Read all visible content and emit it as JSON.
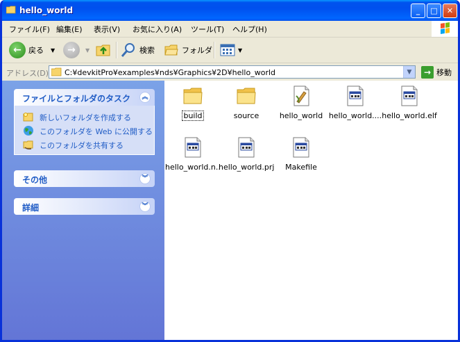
{
  "window": {
    "title": "hello_world",
    "buttons": {
      "minimize": "_",
      "maximize": "□",
      "close": "✕"
    }
  },
  "menu": [
    "ファイル(F)",
    "編集(E)",
    "表示(V)",
    "お気に入り(A)",
    "ツール(T)",
    "ヘルプ(H)"
  ],
  "toolbar": {
    "back": "戻る",
    "search": "検索",
    "folders": "フォルダ"
  },
  "address": {
    "label": "アドレス(D)",
    "path": "C:¥devkitPro¥examples¥nds¥Graphics¥2D¥hello_world",
    "go": "移動"
  },
  "sidebar": {
    "tasks": {
      "title": "ファイルとフォルダのタスク",
      "items": [
        "新しいフォルダを作成する",
        "このフォルダを Web に公開する",
        "このフォルダを共有する"
      ]
    },
    "other": {
      "title": "その他"
    },
    "details": {
      "title": "詳細"
    }
  },
  "files": [
    {
      "name": "build",
      "type": "folder"
    },
    {
      "name": "source",
      "type": "folder"
    },
    {
      "name": "hello_world",
      "type": "exe"
    },
    {
      "name": "hello_world....",
      "type": "doc"
    },
    {
      "name": "hello_world.elf",
      "type": "doc"
    },
    {
      "name": "hello_world.n...",
      "type": "doc"
    },
    {
      "name": "hello_world.prj",
      "type": "doc"
    },
    {
      "name": "Makefile",
      "type": "doc"
    }
  ]
}
